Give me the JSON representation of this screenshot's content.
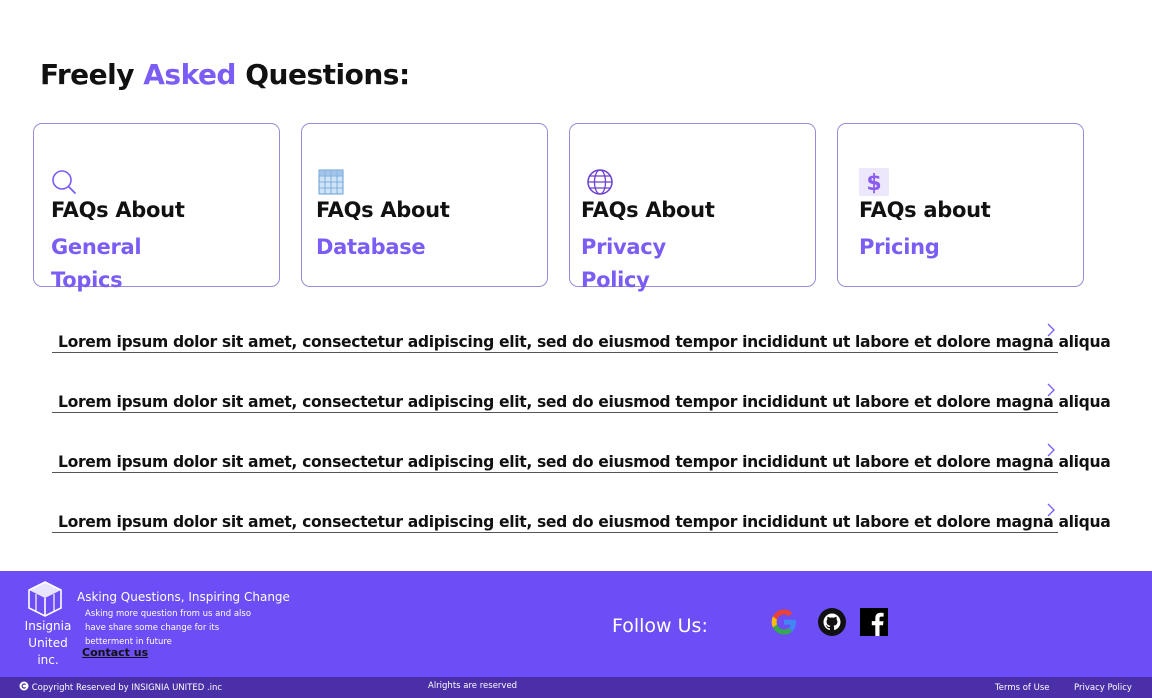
{
  "heading": {
    "part1": "Freely",
    "part2": "Asked",
    "part3": "Questions:"
  },
  "categories": [
    {
      "line1": "FAQs About",
      "line2": "General Topics",
      "icon": "search-icon"
    },
    {
      "line1": "FAQs About",
      "line2": "Database",
      "icon": "database-icon"
    },
    {
      "line1": "FAQs About",
      "line2": "Privacy Policy",
      "icon": "globe-icon"
    },
    {
      "line1": "FAQs about",
      "line2": "Pricing",
      "icon": "dollar-icon"
    }
  ],
  "faqs": [
    {
      "question": "Lorem ipsum dolor sit amet, consectetur adipiscing elit, sed do eiusmod tempor incididunt ut labore et dolore magna aliqua"
    },
    {
      "question": "Lorem ipsum dolor sit amet, consectetur adipiscing elit, sed do eiusmod tempor incididunt ut labore et dolore magna aliqua"
    },
    {
      "question": "Lorem ipsum dolor sit amet, consectetur adipiscing elit, sed do eiusmod tempor incididunt ut labore et dolore magna aliqua"
    },
    {
      "question": "Lorem ipsum dolor sit amet, consectetur adipiscing elit, sed do eiusmod tempor incididunt ut labore et dolore magna aliqua"
    }
  ],
  "footer": {
    "brand_line1": "Insignia",
    "brand_line2": "United",
    "brand_line3": "inc.",
    "tagline": "Asking Questions, Inspiring Change",
    "description": "Asking more question from us and also have share some change for its betterment in future",
    "contact_label": "Contact us",
    "follow_label": "Follow Us:",
    "social_icons": [
      "google-icon",
      "github-icon",
      "facebook-icon"
    ],
    "copyright": "Copyright Reserved by INSIGNIA UNITED .inc",
    "rights": "Alrights are reserved",
    "terms_label": "Terms of Use",
    "privacy_label": "Privacy Policy"
  },
  "colors": {
    "accent": "#7b5cf5",
    "footer_bg": "#6d4df6",
    "footer_bottom_bg": "#4a2fa8"
  }
}
